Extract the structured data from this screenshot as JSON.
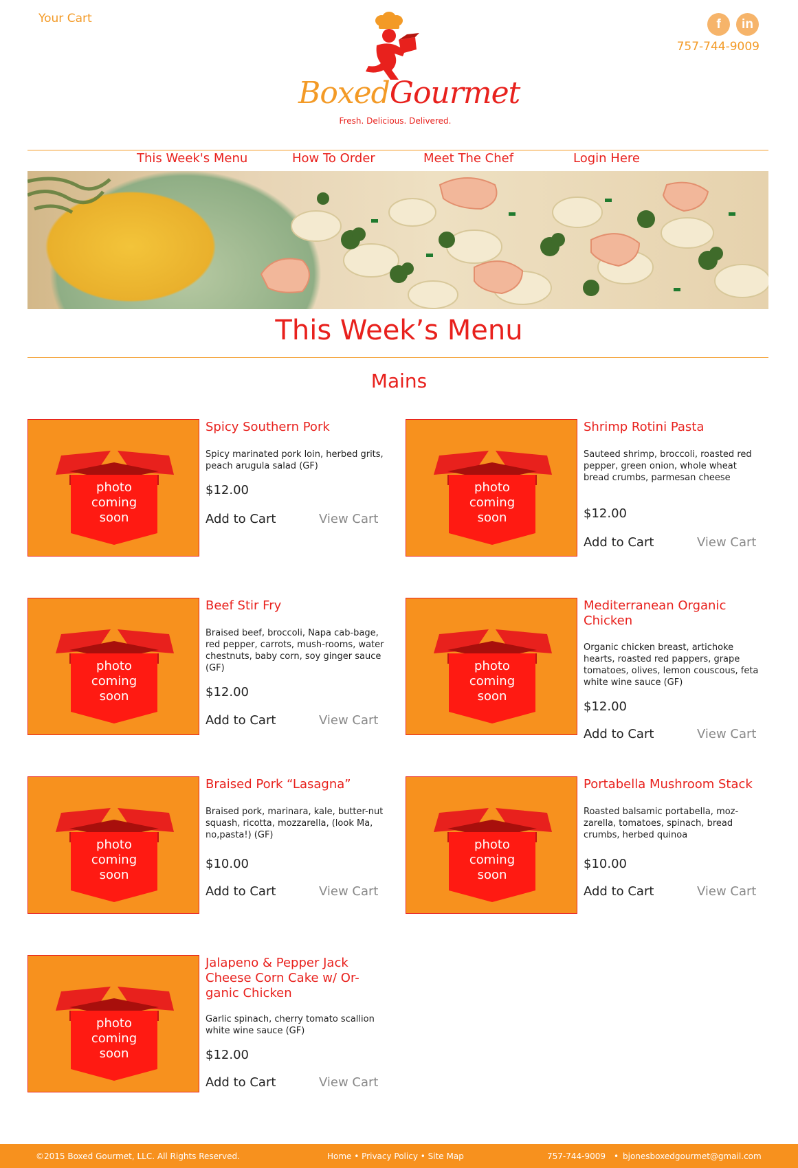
{
  "header": {
    "cart_link": "Your Cart",
    "phone": "757-744-9009",
    "social": [
      "facebook-icon",
      "linkedin-icon"
    ],
    "social_glyphs": [
      "f",
      "in"
    ]
  },
  "logo": {
    "word1": "Boxed",
    "word2": "Gourmet",
    "tagline": "Fresh. Delicious. Delivered."
  },
  "nav": {
    "items": [
      "This Week's Menu",
      "How To Order",
      "Meet The Chef",
      "Login Here"
    ]
  },
  "page": {
    "title": "This Week’s Menu",
    "section": "Mains"
  },
  "placeholder": {
    "line1": "photo",
    "line2": "coming",
    "line3": "soon"
  },
  "actions": {
    "add": "Add to Cart",
    "view": "View Cart"
  },
  "items": [
    {
      "name": "Spicy Southern Pork",
      "description": "Spicy marinated pork loin,  herbed grits, peach arugula salad (GF)",
      "price": "$12.00"
    },
    {
      "name": "Shrimp Rotini Pasta",
      "description": "Sauteed shrimp, broccoli, roasted red pepper, green onion, whole wheat bread crumbs, parmesan cheese",
      "price": "$12.00"
    },
    {
      "name": "Beef Stir Fry",
      "description": "Braised beef, broccoli, Napa cab-bage, red pepper, carrots, mush-rooms, water chestnuts, baby corn, soy ginger sauce (GF)",
      "price": "$12.00"
    },
    {
      "name": "Mediterranean Organic Chicken",
      "description": "Organic chicken breast, artichoke hearts, roasted red pappers, grape tomatoes, olives, lemon couscous, feta white wine sauce (GF)",
      "price": "$12.00"
    },
    {
      "name": "Braised Pork “Lasagna”",
      "description": "Braised pork, marinara, kale, butter-nut squash, ricotta, mozzarella, (look Ma, no,pasta!) (GF)",
      "price": "$10.00"
    },
    {
      "name": "Portabella Mushroom Stack",
      "description": "Roasted balsamic portabella, moz-zarella, tomatoes, spinach, bread crumbs, herbed quinoa",
      "price": "$10.00"
    },
    {
      "name": "Jalapeno & Pepper Jack Cheese Corn Cake w/ Or-ganic Chicken",
      "description": "Garlic spinach, cherry tomato scallion white wine sauce (GF)",
      "price": "$12.00"
    }
  ],
  "footer": {
    "copyright": "©2015 Boxed Gourmet, LLC. All Rights Reserved.",
    "links": "Home  •  Privacy Policy  •  Site Map",
    "phone": "757-744-9009",
    "separator": "•",
    "email": "bjonesboxedgourmet@gmail.com"
  },
  "colors": {
    "brand_red": "#e8211d",
    "brand_orange": "#f39a26",
    "placeholder_orange": "#f7911e"
  }
}
